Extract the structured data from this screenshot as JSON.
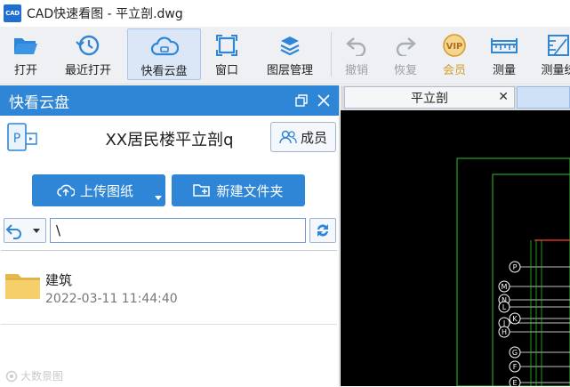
{
  "window": {
    "logo_text": "CAD",
    "title": "CAD快速看图 - 平立剖.dwg"
  },
  "toolbar": {
    "open": "打开",
    "recent": "最近打开",
    "quick_cloud": "快看云盘",
    "window": "窗口",
    "layers": "图层管理",
    "undo": "撤销",
    "redo": "恢复",
    "vip_badge": "VIP",
    "member": "会员",
    "measure": "测量",
    "measure_stats": "测量统"
  },
  "panel": {
    "title": "快看云盘",
    "cloud_name": "XX居民楼平立剖q",
    "members_label": "成员",
    "upload_label": "上传图纸",
    "new_folder_label": "新建文件夹",
    "path_value": "\\",
    "items": [
      {
        "name": "建筑",
        "date": "2022-03-11 11:44:40"
      }
    ]
  },
  "watermark": "大数景图",
  "document": {
    "tab_label": "平立剖",
    "tab_close": "✕"
  },
  "drawing_labels": [
    "P",
    "M",
    "N",
    "L",
    "K",
    "J",
    "H",
    "G",
    "F",
    "E"
  ],
  "colors": {
    "accent": "#2f86d6",
    "vip": "#d89a2a",
    "cad_green": "#2fbf2f",
    "cad_white": "#ffffff",
    "cad_red": "#ff3b30"
  }
}
